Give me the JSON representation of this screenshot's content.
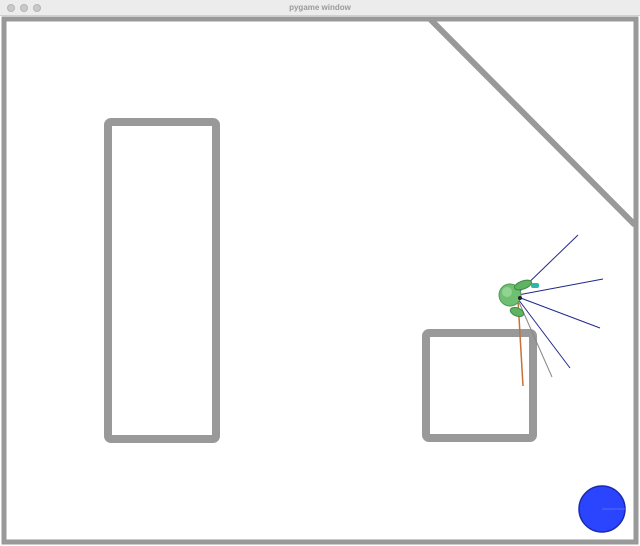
{
  "window": {
    "title": "pygame window"
  },
  "scene": {
    "wall_color": "#999999",
    "background_color": "#ffffff",
    "agent_body_color": "#6fbf73",
    "agent_light_color": "#9fdc9f",
    "sensor_color": "#1f2a8a",
    "heading_color": "#c8703a",
    "target_color": "#2b45ff",
    "target_edge_color": "#1a2bb3"
  }
}
